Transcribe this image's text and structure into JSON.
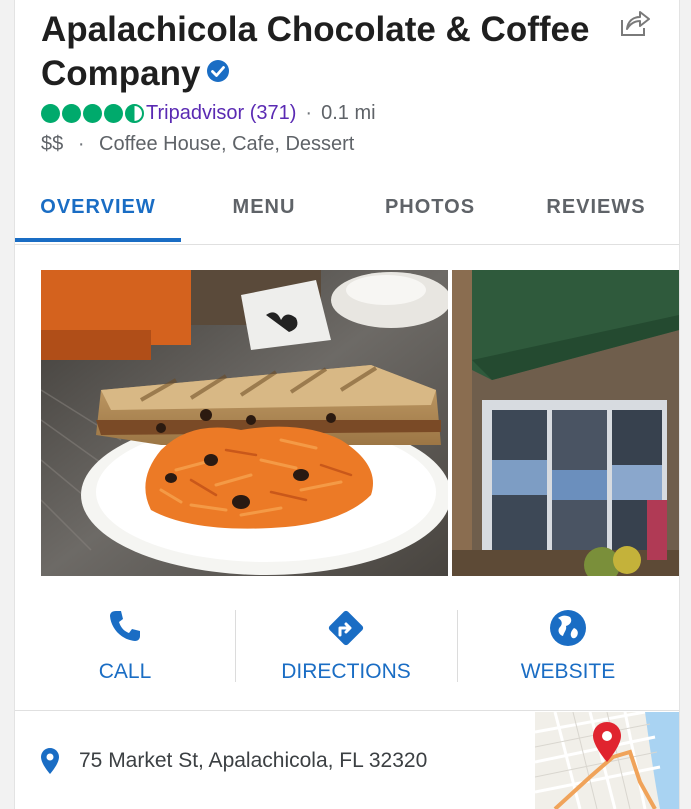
{
  "business": {
    "name": "Apalachicola Chocolate & Coffee Company",
    "rating_value": 4.5,
    "rating_source": "Tripadvisor (371)",
    "distance": "0.1 mi",
    "price": "$$",
    "categories": "Coffee House, Cafe, Dessert"
  },
  "tabs": [
    {
      "label": "OVERVIEW",
      "active": true
    },
    {
      "label": "MENU",
      "active": false
    },
    {
      "label": "PHOTOS",
      "active": false
    },
    {
      "label": "REVIEWS",
      "active": false
    }
  ],
  "actions": {
    "call": "CALL",
    "directions": "DIRECTIONS",
    "website": "WEBSITE"
  },
  "address": "75 Market St, Apalachicola, FL 32320",
  "icons": [
    "verified-check-icon",
    "share-icon",
    "phone-icon",
    "directions-icon",
    "globe-icon",
    "location-pin-icon",
    "map-pin-icon"
  ],
  "colors": {
    "accent_blue": "#1a6dc4",
    "tripadvisor_green": "#00aa6c",
    "tripadvisor_link": "#5a2ab3",
    "map_pin_red": "#e0242f"
  }
}
